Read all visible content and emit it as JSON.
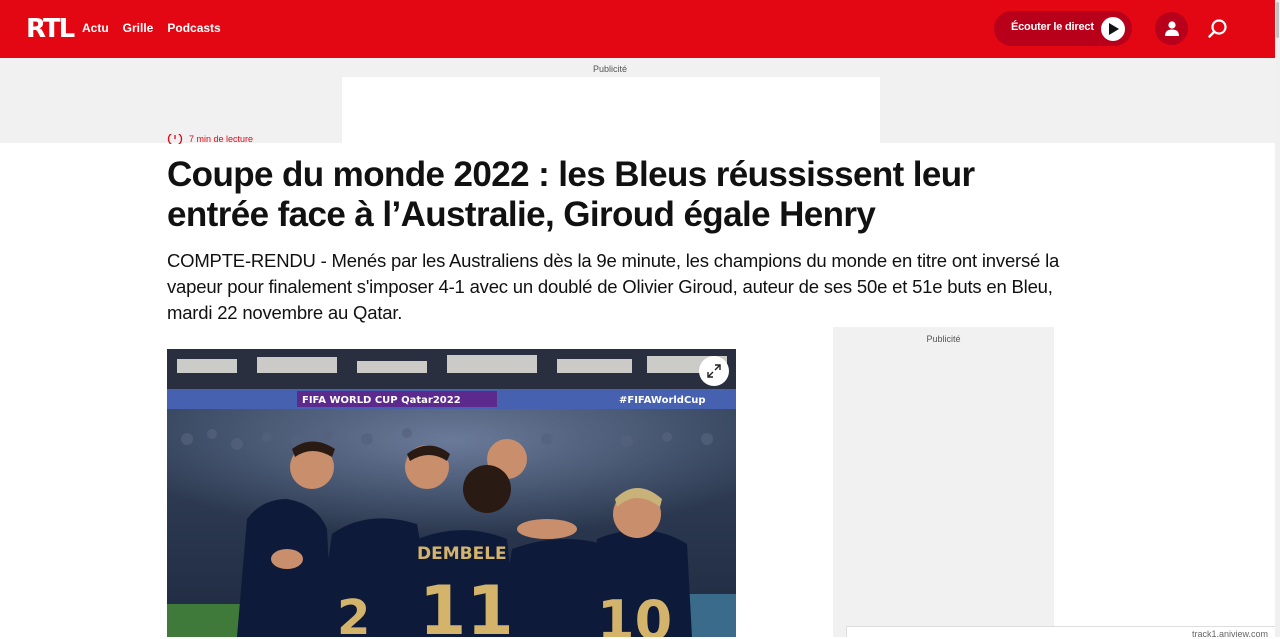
{
  "header": {
    "logo": "RTL",
    "nav": [
      "Actu",
      "Grille",
      "Podcasts"
    ],
    "listen_label": "Écouter le direct",
    "brand_color": "#e30613",
    "dark_red": "#b8001a"
  },
  "ads": {
    "top_label": "Publicité",
    "side_label": "Publicité"
  },
  "article": {
    "reading_time": "7 min de lecture",
    "title": "Coupe du monde 2022 : les Bleus réussissent leur entrée face à l’Australie, Giroud égale Henry",
    "lead": "COMPTE-RENDU - Menés par les Australiens dès la 9e minute, les champions du monde en titre ont inversé la vapeur pour finalement s'imposer 4-1 avec un doublé de Olivier Giroud, auteur de ses 50e et 51e buts en Bleu, mardi 22 novembre au Qatar.",
    "photo": {
      "banner_left": "FIFA WORLD CUP Qatar2022",
      "banner_right": "#FIFAWorldCup",
      "jersey_name": "DEMBELE",
      "jersey_number": "11",
      "jersey_number_right": "10",
      "jersey_number_left": "2"
    }
  },
  "track": {
    "text": "track1.aniview.com"
  }
}
